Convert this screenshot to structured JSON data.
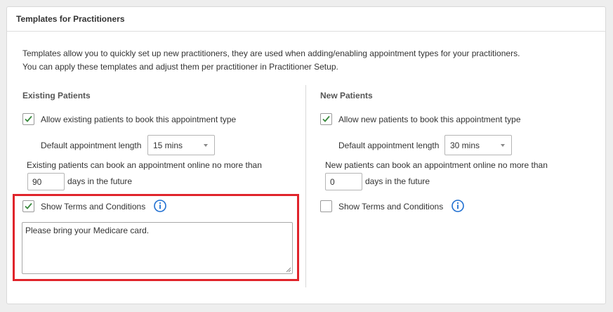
{
  "panel": {
    "title": "Templates for Practitioners",
    "intro_line1": "Templates allow you to quickly set up new practitioners, they are used when adding/enabling appointment types for your practitioners.",
    "intro_line2": "You can apply these templates and adjust them per practitioner in Practitioner Setup."
  },
  "existing": {
    "title": "Existing Patients",
    "allow_label": "Allow existing patients to book this appointment type",
    "allow_checked": true,
    "length_label": "Default appointment length",
    "length_value": "15 mins",
    "future_label": "Existing patients can book an appointment online no more than",
    "future_value": "90",
    "days_label": "days in the future",
    "terms_label": "Show Terms and Conditions",
    "terms_checked": true,
    "terms_text": "Please bring your Medicare card."
  },
  "new_patients": {
    "title": "New Patients",
    "allow_label": "Allow new patients to book this appointment type",
    "allow_checked": true,
    "length_label": "Default appointment length",
    "length_value": "30 mins",
    "future_label": "New patients can book an appointment online no more than",
    "future_value": "0",
    "days_label": "days in the future",
    "terms_label": "Show Terms and Conditions",
    "terms_checked": false
  },
  "colors": {
    "check": "#3a8a3e",
    "info": "#1f6fd1",
    "highlight": "#e0242b"
  },
  "icons": {
    "check": "checkmark-icon",
    "info": "info-circle-icon",
    "caret": "caret-down-icon"
  }
}
